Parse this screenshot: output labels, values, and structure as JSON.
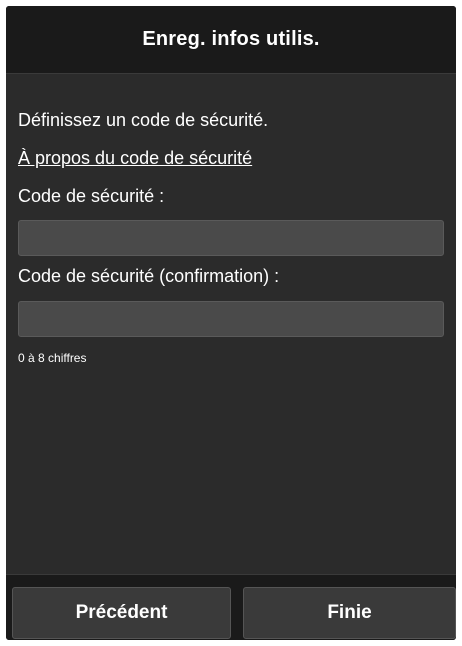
{
  "header": {
    "title": "Enreg. infos utilis."
  },
  "form": {
    "instruction": "Définissez un code de sécurité.",
    "about_link": "À propos du code de sécurité",
    "code_label": "Code de sécurité :",
    "code_value": "",
    "confirm_label": "Code de sécurité (confirmation) :",
    "confirm_value": "",
    "hint": "0 à 8 chiffres"
  },
  "footer": {
    "prev_label": "Précédent",
    "finish_label": "Finie"
  },
  "colors": {
    "background": "#2b2b2b",
    "header": "#1a1a1a",
    "input": "#4a4a4a",
    "text": "#ffffff"
  }
}
